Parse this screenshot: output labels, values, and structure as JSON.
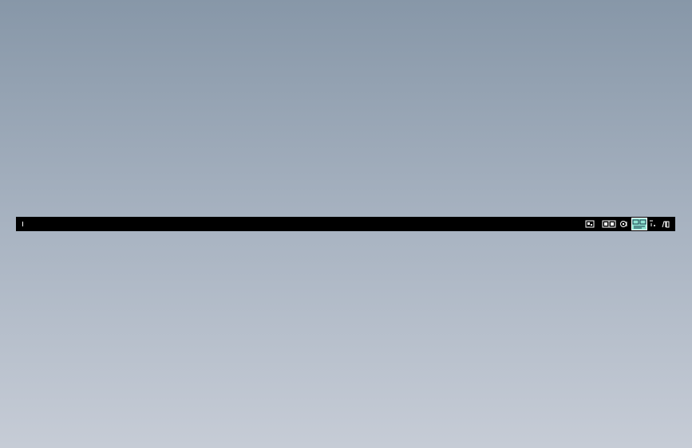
{
  "statusbar": {
    "left_text": "|",
    "tray": [
      {
        "name": "model-space-icon",
        "active": false
      },
      {
        "name": "grid-display-icon",
        "active": false
      },
      {
        "name": "annotation-scale-icon",
        "active": false
      },
      {
        "name": "workspace-switch-icon",
        "active": true
      },
      {
        "name": "lock-ui-icon",
        "active": false
      },
      {
        "name": "clean-screen-icon",
        "active": false
      }
    ]
  },
  "colors": {
    "background_top": "#8797a8",
    "background_bottom": "#c6ccd6",
    "statusbar": "#000000",
    "active_tray": "#8fe3d2"
  }
}
